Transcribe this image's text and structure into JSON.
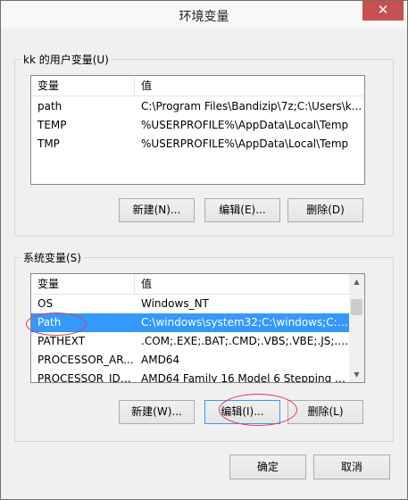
{
  "window": {
    "title": "环境变量",
    "close_glyph": "✕"
  },
  "user_vars": {
    "label": "kk 的用户变量(U)",
    "headers": [
      "变量",
      "值"
    ],
    "rows": [
      {
        "name": "path",
        "value": "C:\\Program Files\\Bandizip\\7z;C:\\Users\\k..."
      },
      {
        "name": "TEMP",
        "value": "%USERPROFILE%\\AppData\\Local\\Temp"
      },
      {
        "name": "TMP",
        "value": "%USERPROFILE%\\AppData\\Local\\Temp"
      }
    ],
    "buttons": {
      "new": "新建(N)...",
      "edit": "编辑(E)...",
      "delete": "删除(D)"
    }
  },
  "system_vars": {
    "label": "系统变量(S)",
    "headers": [
      "变量",
      "值"
    ],
    "rows": [
      {
        "name": "OS",
        "value": "Windows_NT"
      },
      {
        "name": "Path",
        "value": "C:\\windows\\system32;C:\\windows;C:\\win..."
      },
      {
        "name": "PATHEXT",
        "value": ".COM;.EXE;.BAT;.CMD;.VBS;.VBE;.JS;.JSE;..."
      },
      {
        "name": "PROCESSOR_AR...",
        "value": "AMD64"
      },
      {
        "name": "PROCESSOR_IDE...",
        "value": "AMD64 Family 16 Model 6 Stepping 3..."
      }
    ],
    "selected_index": 1,
    "buttons": {
      "new": "新建(W)...",
      "edit": "编辑(I)...",
      "delete": "删除(L)"
    }
  },
  "footer": {
    "ok": "确定",
    "cancel": "取消"
  },
  "colors": {
    "selection": "#3399ff",
    "annotation": "#e03a4a",
    "close": "#c75050"
  }
}
